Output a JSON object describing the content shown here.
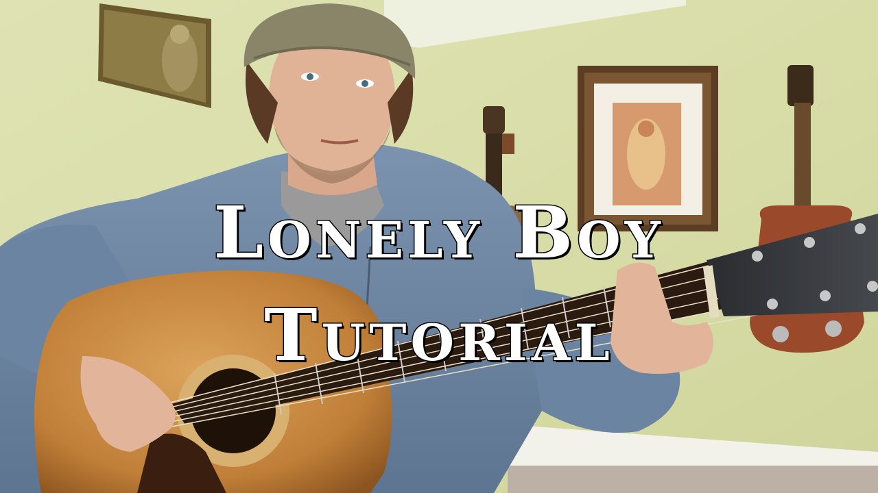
{
  "thumbnail": {
    "title_line_1": "Lonely Boy",
    "title_line_2": "Tutorial"
  },
  "colors": {
    "wall": "#d9dea8",
    "hoodie": "#6f89a6",
    "beanie": "#8a8468",
    "guitar_body": "#c98a3e",
    "title_text": "#ffffff",
    "title_outline": "#0a0a0a"
  }
}
